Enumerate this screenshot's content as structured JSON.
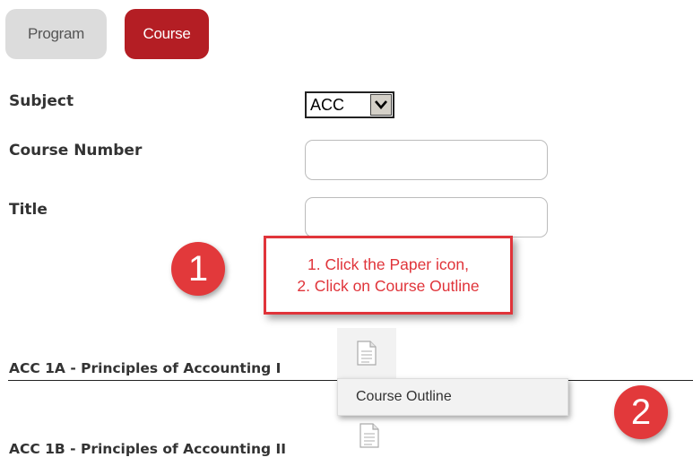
{
  "tabs": {
    "program": "Program",
    "course": "Course"
  },
  "form": {
    "subject_label": "Subject",
    "subject_value": "ACC",
    "course_number_label": "Course Number",
    "course_number_value": "",
    "title_label": "Title",
    "title_value": ""
  },
  "annotation": {
    "badge_1": "1",
    "badge_2": "2",
    "callout_line_1": "1. Click the Paper icon,",
    "callout_line_2": "2. Click on Course Outline"
  },
  "courses": [
    {
      "title": "ACC 1A - Principles of Accounting I",
      "icon": "paper-icon"
    },
    {
      "title": "ACC 1B - Principles of Accounting II",
      "icon": "paper-icon"
    }
  ],
  "dropdown": {
    "item": "Course Outline"
  },
  "colors": {
    "accent": "#b41e24",
    "badge": "#e2393b",
    "inactive_tab": "#dcdcdc"
  }
}
